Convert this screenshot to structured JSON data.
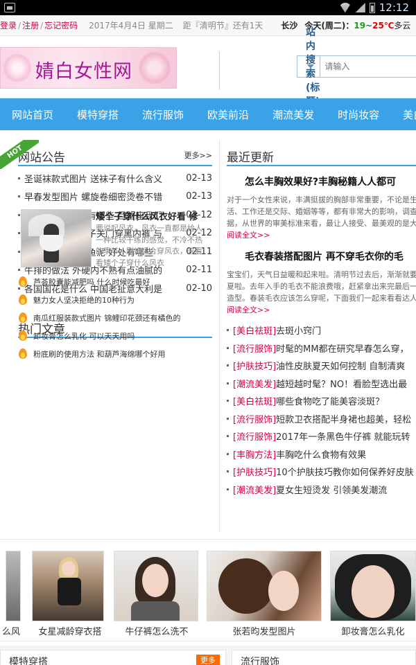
{
  "statusbar": {
    "time": "12:12"
  },
  "topbar": {
    "login": "登录",
    "register": "注册",
    "forgot": "忘记密码",
    "date": "2017年4月4日 星期二",
    "countdown": "距『清明节』还有1天",
    "city": "长沙",
    "today": "今天(周二)：",
    "temp_lo": "19",
    "temp_sep": "~",
    "temp_hi": "25℃",
    "weather": "多云"
  },
  "header": {
    "logo_text": "婧白女性网",
    "search_select": "站内搜索(标题)",
    "search_placeholder": "请输入"
  },
  "nav": [
    "网站首页",
    "模特穿搭",
    "流行服饰",
    "欧美前沿",
    "潮流美发",
    "时尚妆容",
    "美白祛斑"
  ],
  "notice": {
    "ribbon": "HOT",
    "title": "网站公告",
    "more": "更多>>",
    "items": [
      {
        "title": "圣诞袜款式图片 送袜子有什么含义",
        "date": "02-13"
      },
      {
        "title": "早春发型图片 螺旋卷细密烫卷不错",
        "date": "02-13"
      },
      {
        "title": "讲义气的星座男有哪些 巨蟹座我们",
        "date": "02-12"
      },
      {
        "title": "王鸥开门穿白裤子关门穿黑内裤 与",
        "date": "02-12"
      },
      {
        "title": "宝宝多大可以吃鱼泥 好处有哪些",
        "date": "02-11"
      },
      {
        "title": "牛排的做法 外硬内不熟有点油腻的",
        "date": "02-11"
      },
      {
        "title": "各国国花是什么 中国老扯意大利是",
        "date": "02-10"
      }
    ]
  },
  "hot": {
    "title": "热门文章",
    "feature_title": "矮个子穿什么风衣好看 修",
    "feature_desc": "要说起风衣，风衣一直都是给人一种比较干练的感觉，不冷不热的季节，刚好适合穿风衣，来看看矮个子穿什么风衣",
    "items": [
      "芦荟胶囊能减肥吗 什么时候吃最好",
      "魅力女人坚决拒绝的10种行为",
      "南瓜红服装款式图片 锦鲤印花颈还有橘色的",
      "卸妆膏怎么乳化 可以天天用吗",
      "粉底刷的使用方法 和葫芦海绵哪个好用"
    ]
  },
  "latest": {
    "title": "最近更新",
    "articles": [
      {
        "title": "怎么丰胸效果好?丰胸秘籍人人都可",
        "summary": "对于一个女性来说，丰满挺拔的胸部非常重要，不论是生活、工作还是交际、婚姻等等，都有非常大的影响，调查数据，从世界的审美标准来看，最让人接受、最美观的是大...",
        "read": "阅读全文>>"
      },
      {
        "title": "毛衣春装搭配图片 再不穿毛衣你的毛",
        "summary": "宝宝们，天气日益暖和起来啦。清明节过去后，渐渐就要入夏啦。去年入手的毛衣不能浪费哦，赶紧拿出来完最后一波造型。春装毛衣应该怎么穿呢，下面我们一起来看看达人...",
        "read": "阅读全文>>"
      }
    ],
    "items": [
      {
        "cat": "[美白祛斑]",
        "title": "去斑小窍门"
      },
      {
        "cat": "[流行服饰]",
        "title": "时髦的MM都在研究早春怎么穿，"
      },
      {
        "cat": "[护肤技巧]",
        "title": "油性皮肤夏天如何控制 自制清爽"
      },
      {
        "cat": "[潮流美发]",
        "title": "越短越时髦？NO！看脸型选出最"
      },
      {
        "cat": "[美白祛斑]",
        "title": "哪些食物吃了能美容淡斑？"
      },
      {
        "cat": "[流行服饰]",
        "title": "短款卫衣搭配半身裙也超美，轻松"
      },
      {
        "cat": "[流行服饰]",
        "title": "2017年一条黑色牛仔裤 就能玩转"
      },
      {
        "cat": "[丰胸方法]",
        "title": "丰胸吃什么食物有效果"
      },
      {
        "cat": "[护肤技巧]",
        "title": "10个护肤技巧教你如何保养好皮肤"
      },
      {
        "cat": "[潮流美发]",
        "title": "夏女生短烫发 引领美发潮流"
      }
    ]
  },
  "strip": [
    "么风",
    "女星减龄穿衣搭",
    "牛仔裤怎么洗不",
    "张若昀发型图片",
    "卸妆膏怎么乳化"
  ],
  "bottom": {
    "left_title": "模特穿搭",
    "left_more": "更多",
    "right_title": "流行服饰"
  }
}
